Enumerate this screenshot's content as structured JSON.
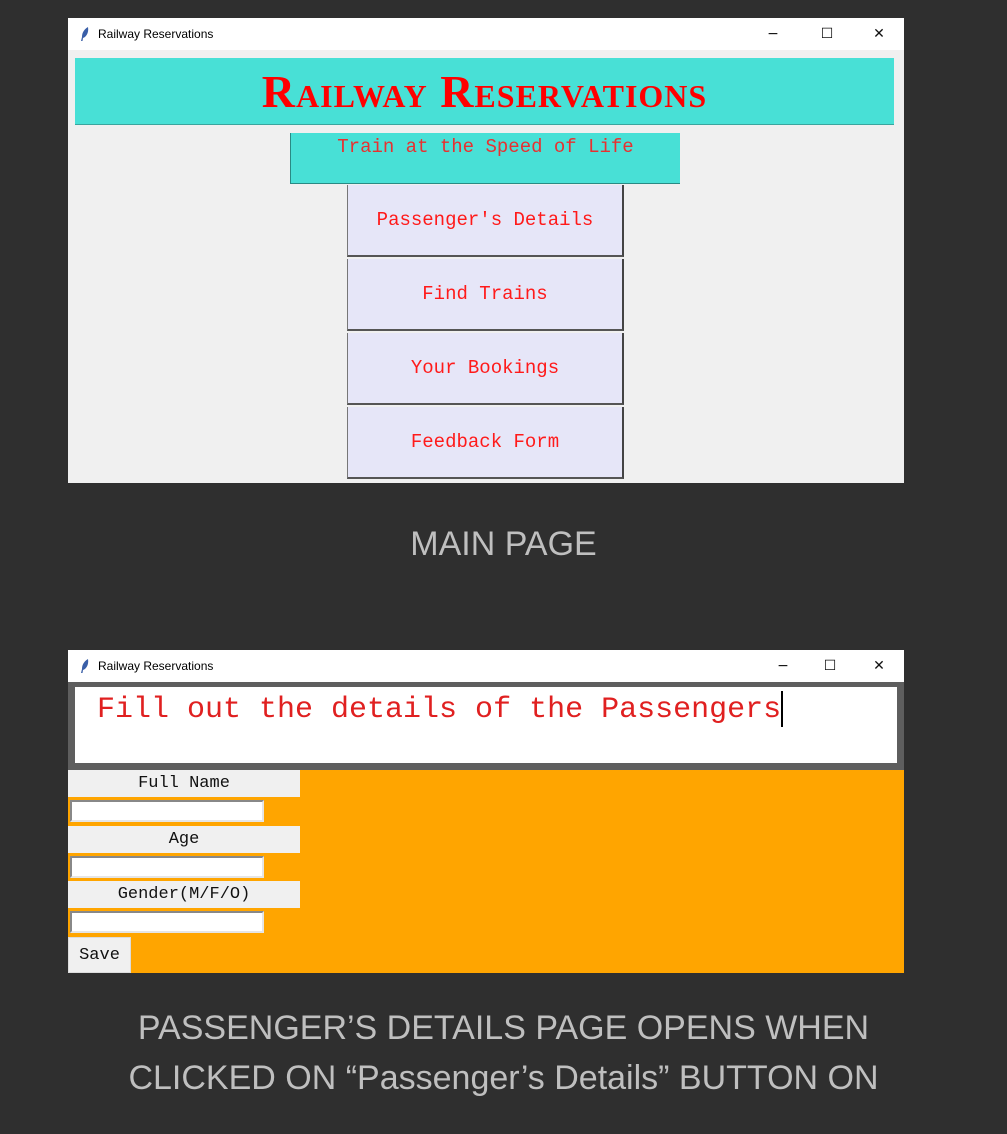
{
  "main_window": {
    "title": "Railway Reservations",
    "controls": {
      "minimize": "−",
      "maximize": "☐",
      "close": "✕"
    },
    "banner_title": "Railway Reservations",
    "tagline": "Train at the Speed of Life",
    "menu": [
      {
        "label": "Passenger's Details"
      },
      {
        "label": "Find Trains"
      },
      {
        "label": "Your Bookings"
      },
      {
        "label": "Feedback Form"
      }
    ]
  },
  "caption_main": "MAIN PAGE",
  "details_window": {
    "title": "Railway Reservations",
    "controls": {
      "minimize": "−",
      "maximize": "☐",
      "close": "✕"
    },
    "heading": "Fill out the details of the Passengers",
    "fields": [
      {
        "label": "Full Name",
        "value": ""
      },
      {
        "label": "Age",
        "value": ""
      },
      {
        "label": "Gender(M/F/O)",
        "value": ""
      }
    ],
    "save_label": "Save"
  },
  "caption_details_line1": "PASSENGER’S DETAILS PAGE OPENS WHEN",
  "caption_details_line2": "CLICKED ON “Passenger’s Details” BUTTON ON",
  "colors": {
    "background": "#2f2f2f",
    "banner": "#48e0d6",
    "banner_text": "#ff0000",
    "menu_button": "#e6e6f8",
    "form_background": "#ffa500"
  }
}
